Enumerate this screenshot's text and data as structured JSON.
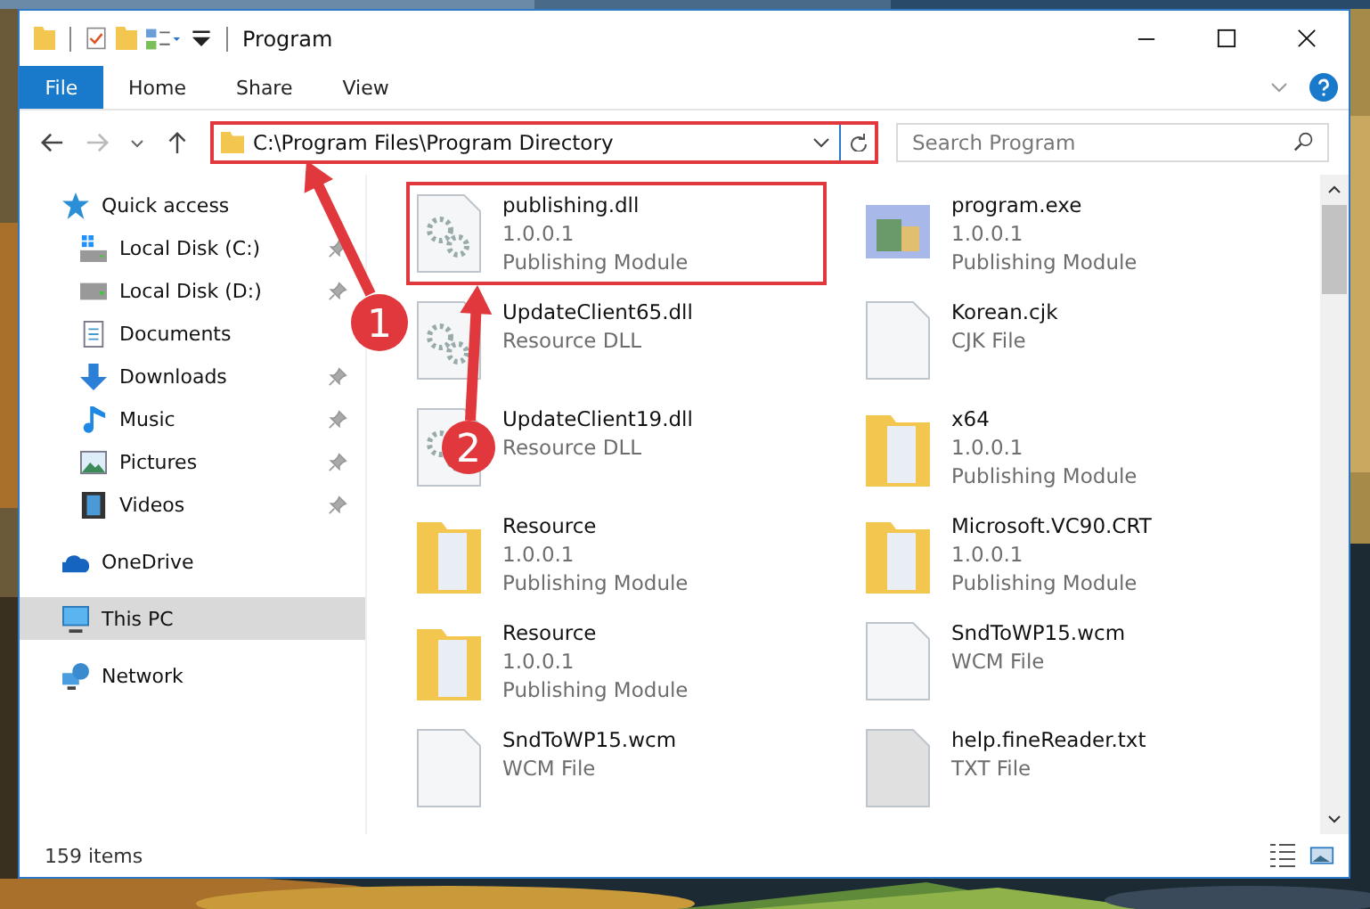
{
  "window": {
    "title": "Program"
  },
  "ribbon_tabs": [
    {
      "label": "File",
      "selected": true
    },
    {
      "label": "Home",
      "selected": false
    },
    {
      "label": "Share",
      "selected": false
    },
    {
      "label": "View",
      "selected": false
    }
  ],
  "address_bar": {
    "path": "C:\\Program Files\\Program Directory",
    "highlighted": true
  },
  "search": {
    "placeholder": "Search Program"
  },
  "sidebar": {
    "items": [
      {
        "label": "Quick access",
        "kind": "star",
        "selected": false,
        "children": [
          {
            "label": "Local Disk (C:)",
            "kind": "system-drive",
            "selected": false,
            "pinned": true
          },
          {
            "label": "Local Disk (D:)",
            "kind": "drive",
            "selected": false,
            "pinned": true
          },
          {
            "label": "Documents",
            "kind": "documents",
            "selected": false,
            "pinned": false
          },
          {
            "label": "Downloads",
            "kind": "downloads",
            "selected": false,
            "pinned": true
          },
          {
            "label": "Music",
            "kind": "music",
            "selected": false,
            "pinned": true
          },
          {
            "label": "Pictures",
            "kind": "pictures",
            "selected": false,
            "pinned": true
          },
          {
            "label": "Videos",
            "kind": "videos",
            "selected": false,
            "pinned": true
          }
        ]
      },
      {
        "label": "OneDrive",
        "kind": "cloud",
        "selected": false
      },
      {
        "label": "This PC",
        "kind": "computer",
        "selected": true
      },
      {
        "label": "Network",
        "kind": "network",
        "selected": false
      }
    ]
  },
  "files": [
    {
      "name": "publishing.dll",
      "details": [
        "1.0.0.1",
        "Publishing Module"
      ],
      "kind": "dll",
      "highlighted": true
    },
    {
      "name": "program.exe",
      "details": [
        "1.0.0.1",
        "Publishing Module"
      ],
      "kind": "exe",
      "highlighted": false
    },
    {
      "name": "UpdateClient65.dll",
      "details": [
        "Resource DLL"
      ],
      "kind": "dll",
      "highlighted": false
    },
    {
      "name": "Korean.cjk",
      "details": [
        "CJK File"
      ],
      "kind": "file",
      "highlighted": false
    },
    {
      "name": "UpdateClient19.dll",
      "details": [
        "Resource DLL"
      ],
      "kind": "dll",
      "highlighted": false
    },
    {
      "name": "x64",
      "details": [
        "1.0.0.1",
        "Publishing Module"
      ],
      "kind": "folder",
      "highlighted": false
    },
    {
      "name": "Resource",
      "details": [
        "1.0.0.1",
        "Publishing Module"
      ],
      "kind": "folder",
      "highlighted": false
    },
    {
      "name": "Microsoft.VC90.CRT",
      "details": [
        "1.0.0.1",
        "Publishing Module"
      ],
      "kind": "folder",
      "highlighted": false
    },
    {
      "name": "Resource",
      "details": [
        "1.0.0.1",
        "Publishing Module"
      ],
      "kind": "folder",
      "highlighted": false
    },
    {
      "name": "SndToWP15.wcm",
      "details": [
        "WCM File"
      ],
      "kind": "file",
      "highlighted": false
    },
    {
      "name": "SndToWP15.wcm",
      "details": [
        "WCM File"
      ],
      "kind": "file",
      "highlighted": false
    },
    {
      "name": "help.fineReader.txt",
      "details": [
        "TXT File"
      ],
      "kind": "txt",
      "highlighted": false
    }
  ],
  "status_bar": {
    "item_count": "159 items"
  },
  "callouts": [
    {
      "number": "1"
    },
    {
      "number": "2"
    }
  ]
}
